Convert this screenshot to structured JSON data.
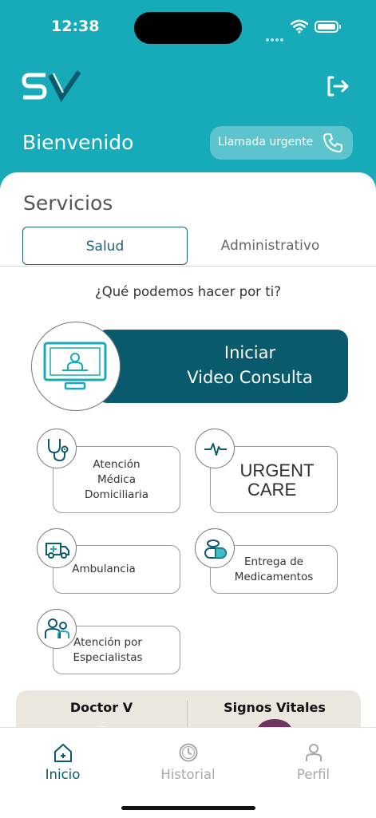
{
  "status_bar": {
    "time": "12:38"
  },
  "header": {
    "welcome": "Bienvenido",
    "urgent_call_label": "Llamada urgente",
    "logout_icon": "logout-icon",
    "brand_color": "#17aab8"
  },
  "services": {
    "title": "Servicios",
    "tabs": [
      {
        "label": "Salud",
        "active": true
      },
      {
        "label": "Administrativo",
        "active": false
      }
    ],
    "question": "¿Qué podemos hacer por ti?",
    "video_consult": {
      "line1": "Iniciar",
      "line2": "Video Consulta",
      "color": "#0a5a6d"
    },
    "items": [
      {
        "lines": [
          "Atención",
          "Médica",
          "Domiciliaria"
        ],
        "icon": "stethoscope-icon"
      },
      {
        "lines": [
          "URGENT",
          "CARE"
        ],
        "icon": "heartbeat-icon"
      },
      {
        "lines": [
          "Ambulancia"
        ],
        "icon": "ambulance-icon"
      },
      {
        "lines": [
          "Entrega de",
          "Medicamentos"
        ],
        "icon": "pill-bottle-icon"
      },
      {
        "lines": [
          "Atención por",
          "Especialistas"
        ],
        "icon": "specialists-icon"
      }
    ]
  },
  "bottom_cards": [
    {
      "title": "Doctor V"
    },
    {
      "title": "Signos Vitales"
    }
  ],
  "nav": {
    "items": [
      {
        "label": "Inicio",
        "active": true,
        "icon": "home-icon",
        "color": "#0a5a6d"
      },
      {
        "label": "Historial",
        "active": false,
        "icon": "clock-icon",
        "color": "#a8a8a8"
      },
      {
        "label": "Perfil",
        "active": false,
        "icon": "user-icon",
        "color": "#a8a8a8"
      }
    ]
  }
}
